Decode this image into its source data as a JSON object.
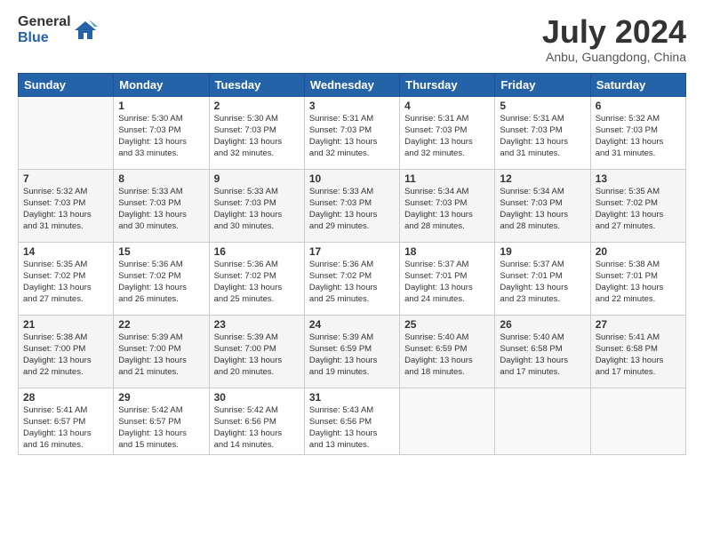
{
  "logo": {
    "general": "General",
    "blue": "Blue"
  },
  "title": "July 2024",
  "subtitle": "Anbu, Guangdong, China",
  "weekdays": [
    "Sunday",
    "Monday",
    "Tuesday",
    "Wednesday",
    "Thursday",
    "Friday",
    "Saturday"
  ],
  "weeks": [
    [
      {
        "day": "",
        "info": ""
      },
      {
        "day": "1",
        "info": "Sunrise: 5:30 AM\nSunset: 7:03 PM\nDaylight: 13 hours\nand 33 minutes."
      },
      {
        "day": "2",
        "info": "Sunrise: 5:30 AM\nSunset: 7:03 PM\nDaylight: 13 hours\nand 32 minutes."
      },
      {
        "day": "3",
        "info": "Sunrise: 5:31 AM\nSunset: 7:03 PM\nDaylight: 13 hours\nand 32 minutes."
      },
      {
        "day": "4",
        "info": "Sunrise: 5:31 AM\nSunset: 7:03 PM\nDaylight: 13 hours\nand 32 minutes."
      },
      {
        "day": "5",
        "info": "Sunrise: 5:31 AM\nSunset: 7:03 PM\nDaylight: 13 hours\nand 31 minutes."
      },
      {
        "day": "6",
        "info": "Sunrise: 5:32 AM\nSunset: 7:03 PM\nDaylight: 13 hours\nand 31 minutes."
      }
    ],
    [
      {
        "day": "7",
        "info": "Sunrise: 5:32 AM\nSunset: 7:03 PM\nDaylight: 13 hours\nand 31 minutes."
      },
      {
        "day": "8",
        "info": "Sunrise: 5:33 AM\nSunset: 7:03 PM\nDaylight: 13 hours\nand 30 minutes."
      },
      {
        "day": "9",
        "info": "Sunrise: 5:33 AM\nSunset: 7:03 PM\nDaylight: 13 hours\nand 30 minutes."
      },
      {
        "day": "10",
        "info": "Sunrise: 5:33 AM\nSunset: 7:03 PM\nDaylight: 13 hours\nand 29 minutes."
      },
      {
        "day": "11",
        "info": "Sunrise: 5:34 AM\nSunset: 7:03 PM\nDaylight: 13 hours\nand 28 minutes."
      },
      {
        "day": "12",
        "info": "Sunrise: 5:34 AM\nSunset: 7:03 PM\nDaylight: 13 hours\nand 28 minutes."
      },
      {
        "day": "13",
        "info": "Sunrise: 5:35 AM\nSunset: 7:02 PM\nDaylight: 13 hours\nand 27 minutes."
      }
    ],
    [
      {
        "day": "14",
        "info": "Sunrise: 5:35 AM\nSunset: 7:02 PM\nDaylight: 13 hours\nand 27 minutes."
      },
      {
        "day": "15",
        "info": "Sunrise: 5:36 AM\nSunset: 7:02 PM\nDaylight: 13 hours\nand 26 minutes."
      },
      {
        "day": "16",
        "info": "Sunrise: 5:36 AM\nSunset: 7:02 PM\nDaylight: 13 hours\nand 25 minutes."
      },
      {
        "day": "17",
        "info": "Sunrise: 5:36 AM\nSunset: 7:02 PM\nDaylight: 13 hours\nand 25 minutes."
      },
      {
        "day": "18",
        "info": "Sunrise: 5:37 AM\nSunset: 7:01 PM\nDaylight: 13 hours\nand 24 minutes."
      },
      {
        "day": "19",
        "info": "Sunrise: 5:37 AM\nSunset: 7:01 PM\nDaylight: 13 hours\nand 23 minutes."
      },
      {
        "day": "20",
        "info": "Sunrise: 5:38 AM\nSunset: 7:01 PM\nDaylight: 13 hours\nand 22 minutes."
      }
    ],
    [
      {
        "day": "21",
        "info": "Sunrise: 5:38 AM\nSunset: 7:00 PM\nDaylight: 13 hours\nand 22 minutes."
      },
      {
        "day": "22",
        "info": "Sunrise: 5:39 AM\nSunset: 7:00 PM\nDaylight: 13 hours\nand 21 minutes."
      },
      {
        "day": "23",
        "info": "Sunrise: 5:39 AM\nSunset: 7:00 PM\nDaylight: 13 hours\nand 20 minutes."
      },
      {
        "day": "24",
        "info": "Sunrise: 5:39 AM\nSunset: 6:59 PM\nDaylight: 13 hours\nand 19 minutes."
      },
      {
        "day": "25",
        "info": "Sunrise: 5:40 AM\nSunset: 6:59 PM\nDaylight: 13 hours\nand 18 minutes."
      },
      {
        "day": "26",
        "info": "Sunrise: 5:40 AM\nSunset: 6:58 PM\nDaylight: 13 hours\nand 17 minutes."
      },
      {
        "day": "27",
        "info": "Sunrise: 5:41 AM\nSunset: 6:58 PM\nDaylight: 13 hours\nand 17 minutes."
      }
    ],
    [
      {
        "day": "28",
        "info": "Sunrise: 5:41 AM\nSunset: 6:57 PM\nDaylight: 13 hours\nand 16 minutes."
      },
      {
        "day": "29",
        "info": "Sunrise: 5:42 AM\nSunset: 6:57 PM\nDaylight: 13 hours\nand 15 minutes."
      },
      {
        "day": "30",
        "info": "Sunrise: 5:42 AM\nSunset: 6:56 PM\nDaylight: 13 hours\nand 14 minutes."
      },
      {
        "day": "31",
        "info": "Sunrise: 5:43 AM\nSunset: 6:56 PM\nDaylight: 13 hours\nand 13 minutes."
      },
      {
        "day": "",
        "info": ""
      },
      {
        "day": "",
        "info": ""
      },
      {
        "day": "",
        "info": ""
      }
    ]
  ]
}
